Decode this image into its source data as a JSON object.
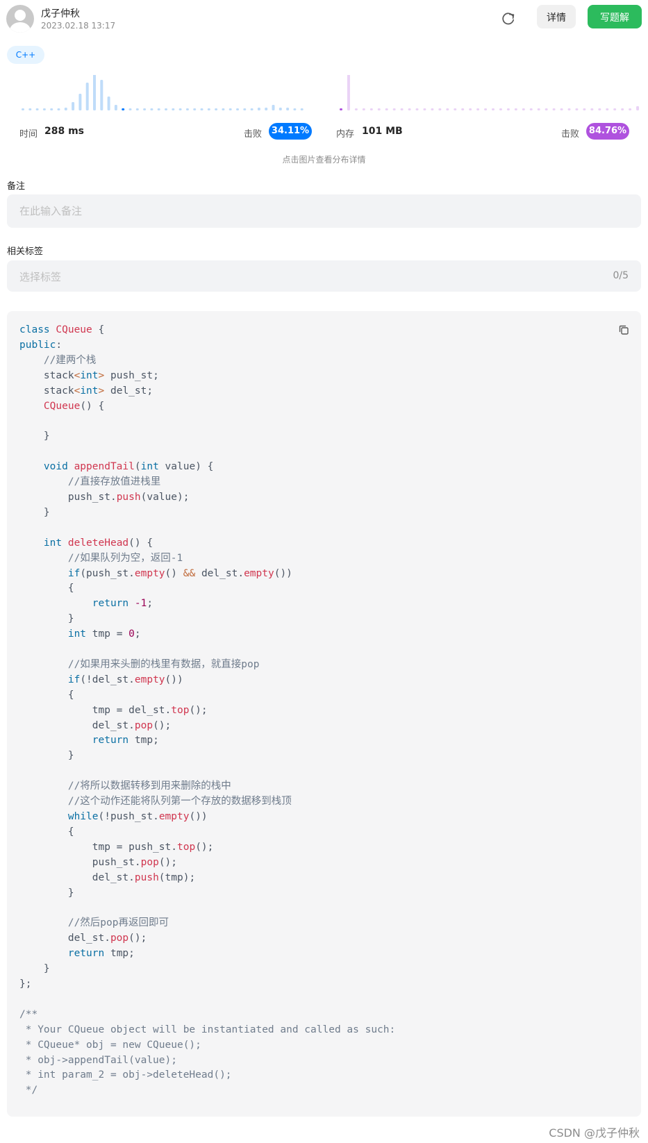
{
  "header": {
    "author": "戊子仲秋",
    "date": "2023.02.18 13:17",
    "refresh_icon": "refresh-icon",
    "detail_label": "详情",
    "write_solution_label": "写题解"
  },
  "language_tag": "C++",
  "runtime": {
    "label": "时间",
    "value": "288 ms",
    "beat_label": "击败",
    "beat_percent": "34.11%",
    "color": "#007aff",
    "bar_color": "#bfdcf9",
    "distribution": [
      0,
      0,
      0,
      0,
      0,
      0,
      1,
      3,
      6,
      10,
      13,
      11,
      5,
      2,
      0,
      0,
      0,
      0,
      0,
      0,
      0,
      0,
      0,
      0,
      0,
      0,
      0,
      0,
      0,
      0,
      0,
      0,
      0,
      1,
      1,
      2,
      1,
      1,
      0,
      0
    ],
    "current_index": 14
  },
  "memory": {
    "label": "内存",
    "value": "101 MB",
    "beat_label": "击败",
    "beat_percent": "84.76%",
    "color": "#af52de",
    "bar_color": "#ead3f6",
    "distribution": [
      0,
      17,
      0,
      0,
      0,
      0,
      0,
      0,
      0,
      0,
      0,
      0,
      0,
      0,
      0,
      0,
      0,
      0,
      0,
      0,
      0,
      0,
      0,
      0,
      0,
      0,
      0,
      0,
      0,
      0,
      0,
      0,
      0,
      0,
      0,
      0,
      0,
      0,
      0,
      2
    ],
    "current_index": 0
  },
  "chart_hint": "点击图片查看分布详情",
  "notes": {
    "label": "备注",
    "placeholder": "在此输入备注"
  },
  "tags": {
    "label": "相关标签",
    "placeholder": "选择标签",
    "count": "0/5"
  },
  "code": {
    "copy_icon": "copy-icon",
    "lines": [
      [
        [
          "kw",
          "class"
        ],
        [
          "p",
          " "
        ],
        [
          "fn",
          "CQueue"
        ],
        [
          "p",
          " {"
        ]
      ],
      [
        [
          "kw",
          "public"
        ],
        [
          "p",
          ":"
        ]
      ],
      [
        [
          "p",
          "    "
        ],
        [
          "cm",
          "//建两个栈"
        ]
      ],
      [
        [
          "p",
          "    stack"
        ],
        [
          "ang",
          "<"
        ],
        [
          "kw",
          "int"
        ],
        [
          "ang",
          ">"
        ],
        [
          "p",
          " push_st;"
        ]
      ],
      [
        [
          "p",
          "    stack"
        ],
        [
          "ang",
          "<"
        ],
        [
          "kw",
          "int"
        ],
        [
          "ang",
          ">"
        ],
        [
          "p",
          " del_st;"
        ]
      ],
      [
        [
          "p",
          "    "
        ],
        [
          "fn",
          "CQueue"
        ],
        [
          "p",
          "() {"
        ]
      ],
      [
        [
          "p",
          ""
        ]
      ],
      [
        [
          "p",
          "    }"
        ]
      ],
      [
        [
          "p",
          ""
        ]
      ],
      [
        [
          "p",
          "    "
        ],
        [
          "kw",
          "void"
        ],
        [
          "p",
          " "
        ],
        [
          "fn",
          "appendTail"
        ],
        [
          "p",
          "("
        ],
        [
          "kw",
          "int"
        ],
        [
          "p",
          " value) {"
        ]
      ],
      [
        [
          "p",
          "        "
        ],
        [
          "cm",
          "//直接存放值进栈里"
        ]
      ],
      [
        [
          "p",
          "        push_st."
        ],
        [
          "fn",
          "push"
        ],
        [
          "p",
          "(value);"
        ]
      ],
      [
        [
          "p",
          "    }"
        ]
      ],
      [
        [
          "p",
          ""
        ]
      ],
      [
        [
          "p",
          "    "
        ],
        [
          "kw",
          "int"
        ],
        [
          "p",
          " "
        ],
        [
          "fn",
          "deleteHead"
        ],
        [
          "p",
          "() {"
        ]
      ],
      [
        [
          "p",
          "        "
        ],
        [
          "cm",
          "//如果队列为空，返回-1"
        ]
      ],
      [
        [
          "p",
          "        "
        ],
        [
          "kw",
          "if"
        ],
        [
          "p",
          "(push_st."
        ],
        [
          "fn",
          "empty"
        ],
        [
          "p",
          "() "
        ],
        [
          "ang",
          "&&"
        ],
        [
          "p",
          " del_st."
        ],
        [
          "fn",
          "empty"
        ],
        [
          "p",
          "())"
        ]
      ],
      [
        [
          "p",
          "        {"
        ]
      ],
      [
        [
          "p",
          "            "
        ],
        [
          "kw",
          "return"
        ],
        [
          "p",
          " "
        ],
        [
          "num",
          "-1"
        ],
        [
          "p",
          ";"
        ]
      ],
      [
        [
          "p",
          "        }"
        ]
      ],
      [
        [
          "p",
          "        "
        ],
        [
          "kw",
          "int"
        ],
        [
          "p",
          " tmp = "
        ],
        [
          "num",
          "0"
        ],
        [
          "p",
          ";"
        ]
      ],
      [
        [
          "p",
          ""
        ]
      ],
      [
        [
          "p",
          "        "
        ],
        [
          "cm",
          "//如果用来头删的栈里有数据，就直接pop"
        ]
      ],
      [
        [
          "p",
          "        "
        ],
        [
          "kw",
          "if"
        ],
        [
          "p",
          "(!del_st."
        ],
        [
          "fn",
          "empty"
        ],
        [
          "p",
          "())"
        ]
      ],
      [
        [
          "p",
          "        {"
        ]
      ],
      [
        [
          "p",
          "            tmp = del_st."
        ],
        [
          "fn",
          "top"
        ],
        [
          "p",
          "();"
        ]
      ],
      [
        [
          "p",
          "            del_st."
        ],
        [
          "fn",
          "pop"
        ],
        [
          "p",
          "();"
        ]
      ],
      [
        [
          "p",
          "            "
        ],
        [
          "kw",
          "return"
        ],
        [
          "p",
          " tmp;"
        ]
      ],
      [
        [
          "p",
          "        }"
        ]
      ],
      [
        [
          "p",
          ""
        ]
      ],
      [
        [
          "p",
          "        "
        ],
        [
          "cm",
          "//将所以数据转移到用来删除的栈中"
        ]
      ],
      [
        [
          "p",
          "        "
        ],
        [
          "cm",
          "//这个动作还能将队列第一个存放的数据移到栈顶"
        ]
      ],
      [
        [
          "p",
          "        "
        ],
        [
          "kw",
          "while"
        ],
        [
          "p",
          "(!push_st."
        ],
        [
          "fn",
          "empty"
        ],
        [
          "p",
          "())"
        ]
      ],
      [
        [
          "p",
          "        {"
        ]
      ],
      [
        [
          "p",
          "            tmp = push_st."
        ],
        [
          "fn",
          "top"
        ],
        [
          "p",
          "();"
        ]
      ],
      [
        [
          "p",
          "            push_st."
        ],
        [
          "fn",
          "pop"
        ],
        [
          "p",
          "();"
        ]
      ],
      [
        [
          "p",
          "            del_st."
        ],
        [
          "fn",
          "push"
        ],
        [
          "p",
          "(tmp);"
        ]
      ],
      [
        [
          "p",
          "        }"
        ]
      ],
      [
        [
          "p",
          ""
        ]
      ],
      [
        [
          "p",
          "        "
        ],
        [
          "cm",
          "//然后pop再返回即可"
        ]
      ],
      [
        [
          "p",
          "        del_st."
        ],
        [
          "fn",
          "pop"
        ],
        [
          "p",
          "();"
        ]
      ],
      [
        [
          "p",
          "        "
        ],
        [
          "kw",
          "return"
        ],
        [
          "p",
          " tmp;"
        ]
      ],
      [
        [
          "p",
          "    }"
        ]
      ],
      [
        [
          "p",
          "};"
        ]
      ],
      [
        [
          "p",
          ""
        ]
      ],
      [
        [
          "cm",
          "/**"
        ]
      ],
      [
        [
          "cm",
          " * Your CQueue object will be instantiated and called as such:"
        ]
      ],
      [
        [
          "cm",
          " * CQueue* obj = new CQueue();"
        ]
      ],
      [
        [
          "cm",
          " * obj->appendTail(value);"
        ]
      ],
      [
        [
          "cm",
          " * int param_2 = obj->deleteHead();"
        ]
      ],
      [
        [
          "cm",
          " */"
        ]
      ]
    ]
  },
  "footer": "CSDN @戊子仲秋"
}
